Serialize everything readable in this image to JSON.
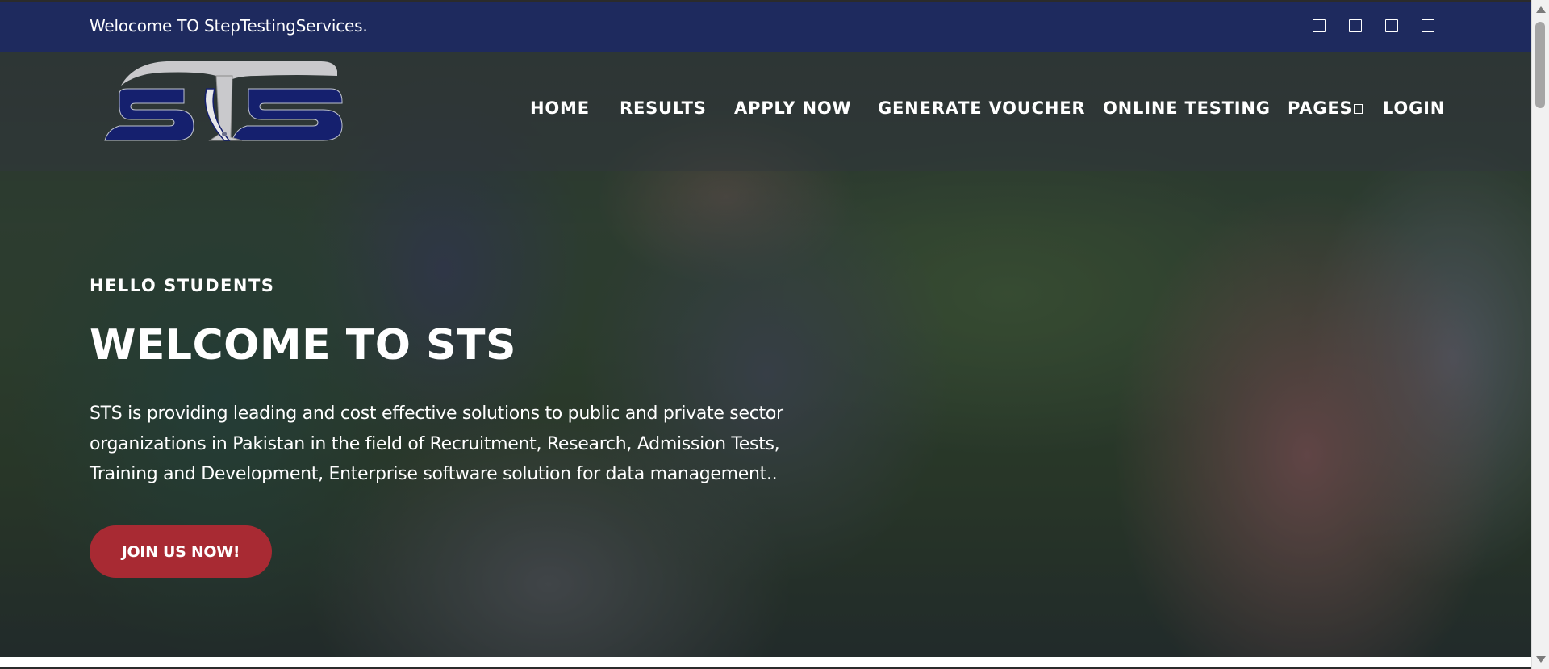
{
  "topbar": {
    "welcome_text": "Welocome TO StepTestingServices.",
    "social_icons": [
      "facebook-icon",
      "twitter-icon",
      "linkedin-icon",
      "instagram-icon"
    ]
  },
  "brand": {
    "logo_text": "STS",
    "primary_color": "#1e2a5e",
    "logo_blue": "#15206e",
    "logo_silver": "#c9c9cc"
  },
  "nav": {
    "items": [
      {
        "label": "HOME"
      },
      {
        "label": "RESULTS"
      },
      {
        "label": "APPLY NOW"
      },
      {
        "label": "GENERATE VOUCHER"
      },
      {
        "label": "ONLINE TESTING"
      },
      {
        "label": "PAGES",
        "has_dropdown": true
      },
      {
        "label": "LOGIN"
      }
    ]
  },
  "hero": {
    "kicker": "HELLO STUDENTS",
    "headline": "WELCOME TO STS",
    "description": "STS is providing leading and cost effective solutions to public and private sector organizations in Pakistan in the field of Recruitment, Research, Admission Tests, Training and Development, Enterprise software solution for data management..",
    "cta_label": "JOIN US NOW!",
    "cta_color": "#a82a33"
  }
}
